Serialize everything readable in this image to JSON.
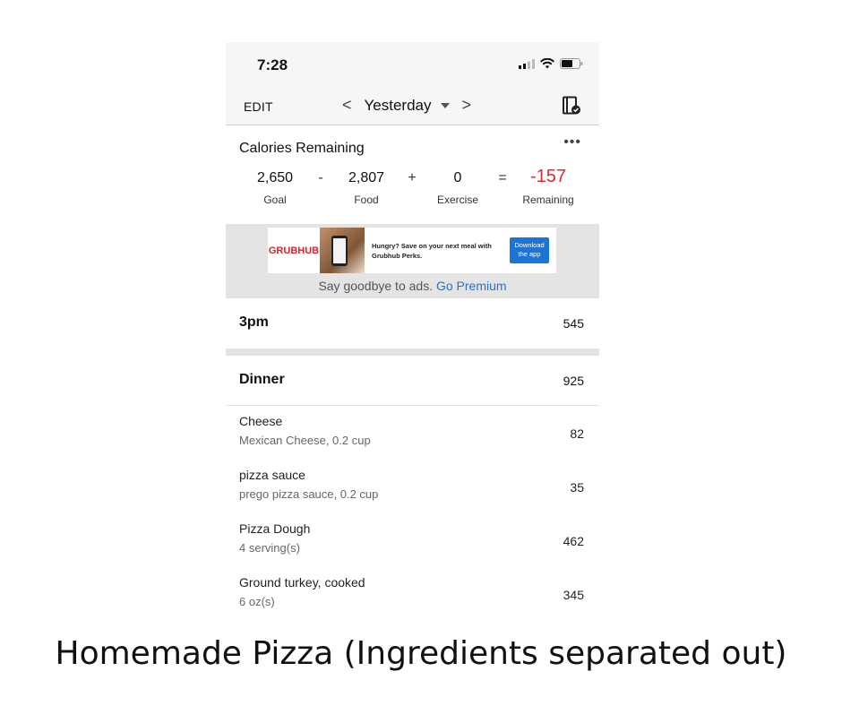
{
  "status_bar": {
    "time": "7:28"
  },
  "nav": {
    "edit_label": "EDIT",
    "date_label": "Yesterday",
    "prev_arrow": "<",
    "next_arrow": ">",
    "diary_icon": "diary-check-icon"
  },
  "calories": {
    "title": "Calories Remaining",
    "more": "•••",
    "goal": {
      "value": "2,650",
      "label": "Goal"
    },
    "op_minus": "-",
    "food": {
      "value": "2,807",
      "label": "Food"
    },
    "op_plus": "+",
    "exercise": {
      "value": "0",
      "label": "Exercise"
    },
    "op_equals": "=",
    "remaining": {
      "value": "-157",
      "label": "Remaining"
    },
    "remaining_color": "#e02b2b"
  },
  "ad": {
    "logo": "GRUBHUB",
    "text": "Hungry? Save on your next meal with Grubhub Perks.",
    "cta": "Download the app",
    "footer_text": "Say goodbye to ads.",
    "footer_link": "Go Premium"
  },
  "meals": {
    "snack": {
      "name": "3pm",
      "calories": "545"
    },
    "dinner": {
      "name": "Dinner",
      "calories": "925",
      "items": [
        {
          "name": "Cheese",
          "desc": "Mexican Cheese, 0.2 cup",
          "calories": "82"
        },
        {
          "name": "pizza sauce",
          "desc": "prego pizza sauce, 0.2 cup",
          "calories": "35"
        },
        {
          "name": "Pizza Dough",
          "desc": "4 serving(s)",
          "calories": "462"
        },
        {
          "name": "Ground turkey, cooked",
          "desc": "6 oz(s)",
          "calories": "345"
        }
      ]
    }
  },
  "caption": "Homemade Pizza (Ingredients separated out)",
  "colors": {
    "accent_blue": "#1e74d6",
    "brand_red": "#e0202e"
  }
}
